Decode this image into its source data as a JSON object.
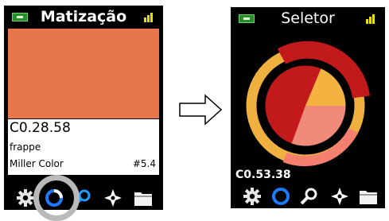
{
  "left_screen": {
    "title": "Matização",
    "swatch_color": "#E8764B",
    "color_code": "C0.28.58",
    "color_name": "frappe",
    "brand": "Miller Color",
    "number": "#5.4",
    "toolbar_icons": [
      "gear-icon",
      "hue-ring-icon",
      "search-icon",
      "compass-icon",
      "folder-icon"
    ]
  },
  "right_screen": {
    "title": "Seletor",
    "color_code": "C0.53.38",
    "toolbar_icons": [
      "gear-icon",
      "hue-ring-icon",
      "search-icon",
      "compass-icon",
      "folder-icon"
    ],
    "wheel_colors": {
      "outer_ring": "#F0B040",
      "outer_red_arc": "#C21A1A",
      "outer_light_arc": "#F47F6F",
      "inner_red": "#C21A1A",
      "inner_yellow": "#F4B240",
      "inner_salmon": "#F08A7A"
    }
  },
  "colors": {
    "battery": "#2A8B2A",
    "signal": "#E8E000",
    "active_tool": "#1E7BFF",
    "highlight": "#B9B9B9"
  }
}
